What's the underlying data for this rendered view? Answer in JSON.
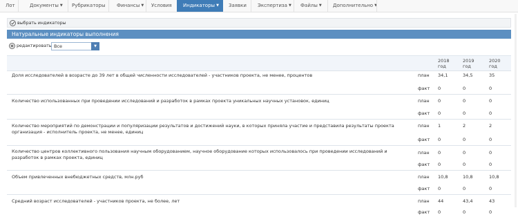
{
  "nav": {
    "items": [
      {
        "label": "Лот",
        "dropdown": false
      },
      {
        "label": "Документы",
        "dropdown": true
      },
      {
        "label": "Рубрикаторы",
        "dropdown": false
      },
      {
        "label": "Финансы",
        "dropdown": true
      },
      {
        "label": "Условия",
        "dropdown": false
      },
      {
        "label": "Индикаторы",
        "dropdown": true,
        "active": true
      },
      {
        "label": "Заявки",
        "dropdown": false
      },
      {
        "label": "Экспертиза",
        "dropdown": true
      },
      {
        "label": "Файлы",
        "dropdown": true
      },
      {
        "label": "Дополнительно",
        "dropdown": true
      }
    ]
  },
  "toolbar": {
    "choose_label": "выбрать индикаторы"
  },
  "section": {
    "title": "Натуральные индикаторы выполнения"
  },
  "filter": {
    "edit_label": "редактировать",
    "select_value": "Все"
  },
  "table": {
    "years": [
      {
        "year": "2018",
        "unit": "год"
      },
      {
        "year": "2019",
        "unit": "год"
      },
      {
        "year": "2020",
        "unit": "год"
      }
    ],
    "plan_label": "план",
    "fact_label": "факт",
    "indicators": [
      {
        "label": "Доля исследователей в возрасте до 39 лет в общей численности исследователей - участников проекта, не менее, процентов",
        "plan": [
          "34,1",
          "34,5",
          "35"
        ],
        "fact": [
          "0",
          "0",
          "0"
        ]
      },
      {
        "label": "Количество использованных при проведении исследований и разработок в рамках проекта уникальных научных установок, единиц",
        "plan": [
          "0",
          "0",
          "0"
        ],
        "fact": [
          "0",
          "0",
          "0"
        ]
      },
      {
        "label": "Количество мероприятий по демонстрации и популяризации результатов и достижений науки, в которых приняла участие и представила результаты проекта организация - исполнитель проекта, не менее, единиц",
        "plan": [
          "1",
          "2",
          "2"
        ],
        "fact": [
          "0",
          "0",
          "0"
        ]
      },
      {
        "label": "Количество центров коллективного пользования научным оборудованием, научное оборудование которых использовалось при проведении исследований и разработок в рамках проекта, единиц",
        "plan": [
          "0",
          "0",
          "0"
        ],
        "fact": [
          "0",
          "0",
          "0"
        ]
      },
      {
        "label": "Объем привлеченных внебюджетных средств, млн.руб",
        "plan": [
          "10,8",
          "10,8",
          "10,8"
        ],
        "fact": [
          "0",
          "0",
          "0"
        ]
      },
      {
        "label": "Средний возраст исследователей - участников проекта, не более, лет",
        "plan": [
          "44",
          "43,4",
          "43"
        ],
        "fact": [
          "0",
          "0",
          "0"
        ]
      }
    ]
  }
}
